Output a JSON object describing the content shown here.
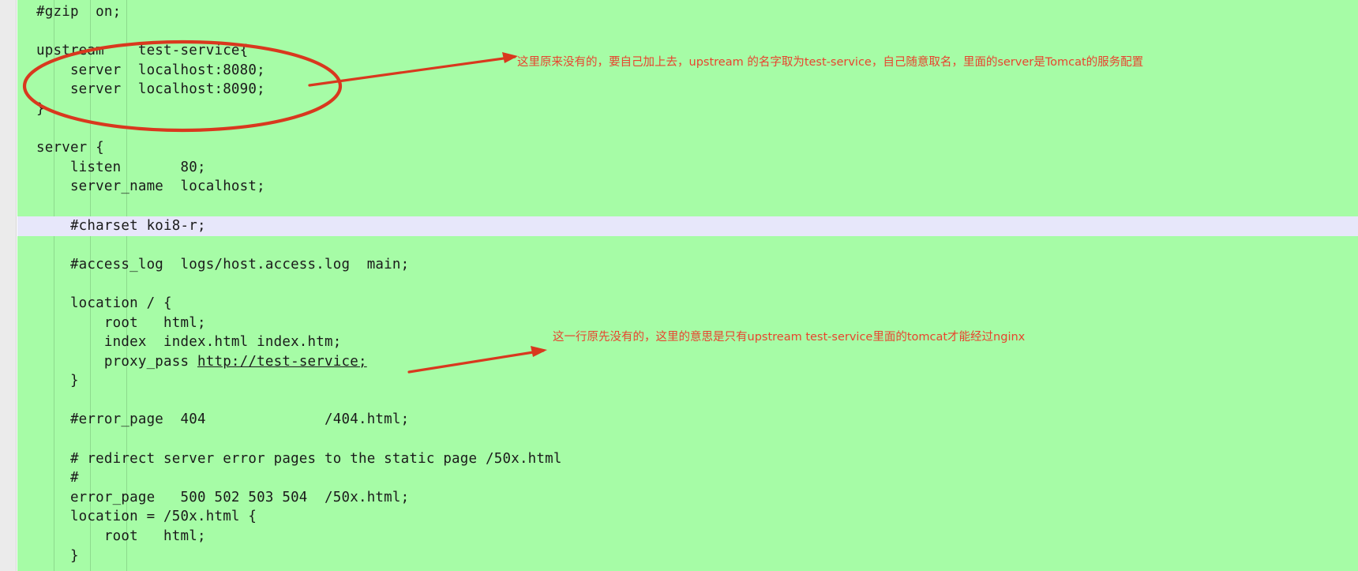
{
  "editor": {
    "file_type": "nginx.conf",
    "background_color": "#a6fca6",
    "gutter_color": "#ebebeb",
    "active_line_color": "#e7e7fa",
    "text_color": "#1a1a1a",
    "active_line_index": 8,
    "code_lines": [
      "#gzip  on;",
      "",
      "upstream    test-service{",
      "    server  localhost:8080;",
      "    server  localhost:8090;",
      "}",
      "",
      "server {",
      "    listen       80;",
      "    server_name  localhost;",
      "",
      "    #charset koi8-r;",
      "",
      "    #access_log  logs/host.access.log  main;",
      "",
      "    location / {",
      "        root   html;",
      "        index  index.html index.htm;",
      "        proxy_pass http://test-service;",
      "    }",
      "",
      "    #error_page  404              /404.html;",
      "",
      "    # redirect server error pages to the static page /50x.html",
      "    #",
      "    error_page   500 502 503 504  /50x.html;",
      "    location = /50x.html {",
      "        root   html;",
      "    }"
    ],
    "linked_text": "http://test-service;"
  },
  "annotations": {
    "color": "#e8442e",
    "items": [
      {
        "id": "upstream-note",
        "text": "这里原来没有的，要自己加上去，upstream 的名字取为test-service，自己随意取名，里面的server是Tomcat的服务配置",
        "shape": "ellipse-with-arrow"
      },
      {
        "id": "proxy-pass-note",
        "text": "这一行原先没有的，这里的意思是只有upstream test-service里面的tomcat才能经过nginx",
        "shape": "arrow"
      }
    ]
  }
}
